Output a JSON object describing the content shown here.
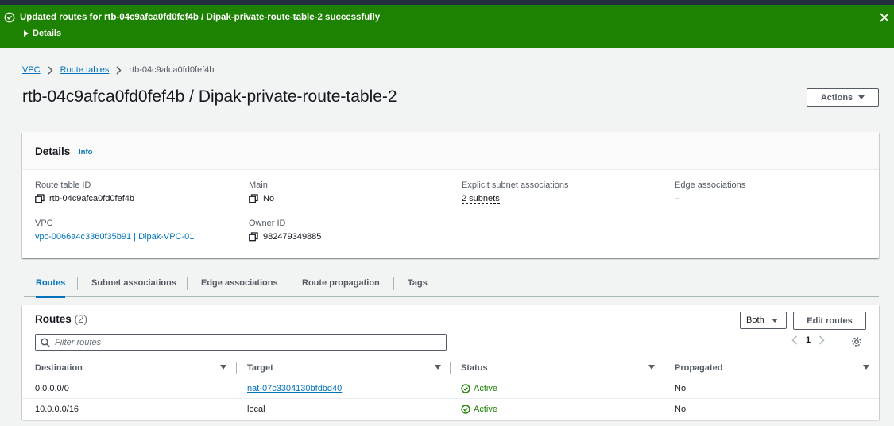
{
  "flash": {
    "message": "Updated routes for rtb-04c9afca0fd0fef4b / Dipak-private-route-table-2 successfully",
    "details_label": "Details",
    "color": "#1d8102"
  },
  "breadcrumb": {
    "items": [
      "VPC",
      "Route tables"
    ],
    "current": "rtb-04c9afca0fd0fef4b"
  },
  "page": {
    "title": "rtb-04c9afca0fd0fef4b / Dipak-private-route-table-2",
    "actions_label": "Actions"
  },
  "details": {
    "header": "Details",
    "info": "Info",
    "route_table_id_label": "Route table ID",
    "route_table_id": "rtb-04c9afca0fd0fef4b",
    "vpc_label": "VPC",
    "vpc": "vpc-0066a4c3360f35b91 | Dipak-VPC-01",
    "main_label": "Main",
    "main": "No",
    "owner_label": "Owner ID",
    "owner": "982479349885",
    "explicit_label": "Explicit subnet associations",
    "explicit": "2 subnets",
    "edge_label": "Edge associations",
    "edge": "–"
  },
  "tabs": [
    {
      "label": "Routes",
      "active": true
    },
    {
      "label": "Subnet associations"
    },
    {
      "label": "Edge associations"
    },
    {
      "label": "Route propagation"
    },
    {
      "label": "Tags"
    }
  ],
  "routes": {
    "title": "Routes",
    "count": "(2)",
    "filter_select": "Both",
    "edit_label": "Edit routes",
    "filter_placeholder": "Filter routes",
    "page": "1",
    "columns": [
      "Destination",
      "Target",
      "Status",
      "Propagated"
    ],
    "rows": [
      {
        "destination": "0.0.0.0/0",
        "target": "nat-07c3304130bfdbd40",
        "status": "Active",
        "propagated": "No"
      },
      {
        "destination": "10.0.0.0/16",
        "target": "local",
        "status": "Active",
        "propagated": "No"
      }
    ]
  },
  "colors": {
    "accent": "#0073bb",
    "success": "#1d8102",
    "dark": "#232f3e"
  }
}
